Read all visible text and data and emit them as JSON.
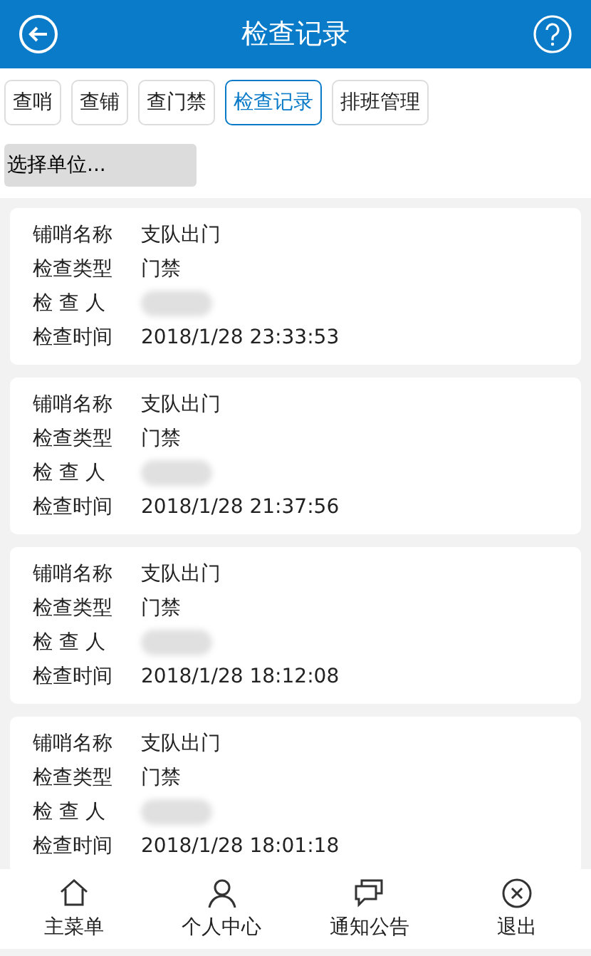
{
  "header": {
    "title": "检查记录"
  },
  "tabs": [
    {
      "label": "查哨",
      "selected": false
    },
    {
      "label": "查铺",
      "selected": false
    },
    {
      "label": "查门禁",
      "selected": false
    },
    {
      "label": "检查记录",
      "selected": true
    },
    {
      "label": "排班管理",
      "selected": false
    }
  ],
  "unit_select": {
    "placeholder": "选择单位..."
  },
  "records": [
    {
      "fields": [
        {
          "label": "铺哨名称",
          "value": "支队出门"
        },
        {
          "label": "检查类型",
          "value": "门禁"
        },
        {
          "label": "检 查 人",
          "redacted": true
        },
        {
          "label": "检查时间",
          "value": "2018/1/28 23:33:53"
        }
      ]
    },
    {
      "fields": [
        {
          "label": "铺哨名称",
          "value": "支队出门"
        },
        {
          "label": "检查类型",
          "value": "门禁"
        },
        {
          "label": "检 查 人",
          "redacted": true
        },
        {
          "label": "检查时间",
          "value": "2018/1/28 21:37:56"
        }
      ]
    },
    {
      "fields": [
        {
          "label": "铺哨名称",
          "value": "支队出门"
        },
        {
          "label": "检查类型",
          "value": "门禁"
        },
        {
          "label": "检 查 人",
          "redacted": true
        },
        {
          "label": "检查时间",
          "value": "2018/1/28 18:12:08"
        }
      ]
    },
    {
      "fields": [
        {
          "label": "铺哨名称",
          "value": "支队出门"
        },
        {
          "label": "检查类型",
          "value": "门禁"
        },
        {
          "label": "检 查 人",
          "redacted": true
        },
        {
          "label": "检查时间",
          "value": "2018/1/28 18:01:18"
        }
      ]
    }
  ],
  "bottom_nav": [
    {
      "kind": "home",
      "label": "主菜单"
    },
    {
      "kind": "person",
      "label": "个人中心"
    },
    {
      "kind": "chat",
      "label": "通知公告"
    },
    {
      "kind": "exit",
      "label": "退出"
    }
  ]
}
